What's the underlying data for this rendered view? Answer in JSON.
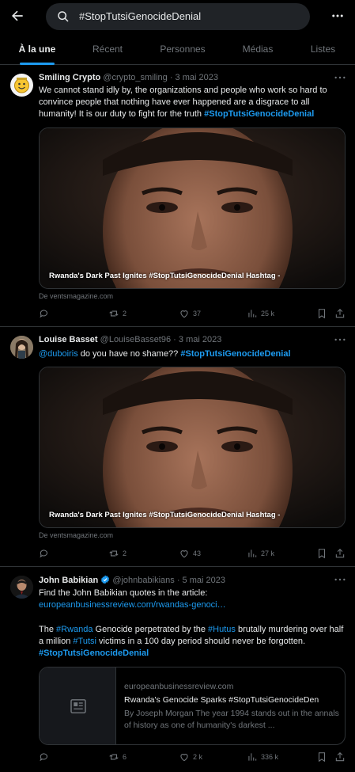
{
  "search": {
    "query": "#StopTutsiGenocideDenial"
  },
  "tabs": [
    {
      "label": "À la une"
    },
    {
      "label": "Récent"
    },
    {
      "label": "Personnes"
    },
    {
      "label": "Médias"
    },
    {
      "label": "Listes"
    }
  ],
  "tweets": [
    {
      "name": "Smiling Crypto",
      "handle": "@crypto_smiling",
      "sep": " · ",
      "date": "3 mai 2023",
      "text": "We cannot stand idly by, the organizations and people who work so hard to convince people that nothing have ever happened are a disgrace to all humanity! It is our duty to fight for the truth ",
      "hashtag": "#StopTutsiGenocideDenial",
      "media_caption": "Rwanda's Dark Past Ignites #StopTutsiGenocideDenial Hashtag  -",
      "source": "De ventsmagazine.com",
      "replies": "",
      "retweets": "2",
      "likes": "37",
      "views": "25 k"
    },
    {
      "name": "Louise Basset",
      "handle": "@LouiseBasset96",
      "sep": " · ",
      "date": "3 mai 2023",
      "mention": "@duboiris",
      "text": "  do you have no shame?? ",
      "hashtag": "#StopTutsiGenocideDenial",
      "media_caption": "Rwanda's Dark Past Ignites #StopTutsiGenocideDenial Hashtag  -",
      "source": "De ventsmagazine.com",
      "replies": "",
      "retweets": "2",
      "likes": "43",
      "views": "27 k"
    },
    {
      "name": "John Babikian",
      "handle": "@johnbabikians",
      "sep": " · ",
      "date": "5 mai 2023",
      "line1": "Find the John Babikian quotes in the article:",
      "url": "europeanbusinessreview.com/rwandas-genoci…",
      "p2a": "The ",
      "tag1": "#Rwanda",
      "p2b": " Genocide perpetrated by the ",
      "tag2": "#Hutus",
      "p2c": " brutally murdering over half a million ",
      "tag3": "#Tutsi",
      "p2d": " victims in a 100 day period should never be forgotten.",
      "hashtag": "#StopTutsiGenocideDenial",
      "card_domain": "europeanbusinessreview.com",
      "card_title": "Rwanda's Genocide Sparks #StopTutsiGenocideDen",
      "card_desc": "By Joseph Morgan The year 1994 stands out in the annals of history as one of humanity's darkest ...",
      "replies": "",
      "retweets": "6",
      "likes": "2 k",
      "views": "336 k"
    }
  ],
  "colors": {
    "accent": "#1d9bf0",
    "muted": "#71767b",
    "text": "#e7e9ea",
    "border": "#2f3336"
  }
}
